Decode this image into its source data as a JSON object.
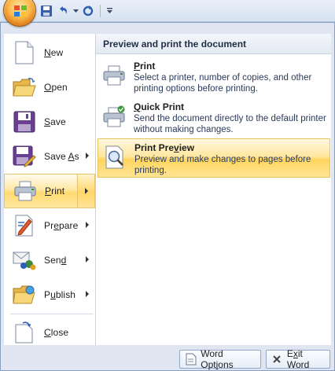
{
  "quick_access": {
    "save_icon": "save-icon",
    "undo_icon": "undo-icon",
    "redo_icon": "redo-icon",
    "customize_icon": "customize-qat-icon"
  },
  "left_menu": [
    {
      "label": "New",
      "accel": "N",
      "icon": "new-document-icon",
      "has_submenu": false
    },
    {
      "label": "Open",
      "accel": "O",
      "icon": "open-folder-icon",
      "has_submenu": false
    },
    {
      "label": "Save",
      "accel": "S",
      "icon": "save-disk-icon",
      "has_submenu": false
    },
    {
      "label": "Save As",
      "accel": "A",
      "icon": "save-as-icon",
      "has_submenu": true
    },
    {
      "label": "Print",
      "accel": "P",
      "icon": "printer-icon",
      "has_submenu": true,
      "selected": true
    },
    {
      "label": "Prepare",
      "accel": "E",
      "icon": "prepare-icon",
      "has_submenu": true
    },
    {
      "label": "Send",
      "accel": "D",
      "icon": "send-icon",
      "has_submenu": true
    },
    {
      "label": "Publish",
      "accel": "U",
      "icon": "publish-icon",
      "has_submenu": true
    },
    {
      "label": "Close",
      "accel": "C",
      "icon": "close-folder-icon",
      "has_submenu": false
    }
  ],
  "left_labels": {
    "new_pre": "",
    "new_acc": "N",
    "new_post": "ew",
    "open_pre": "",
    "open_acc": "O",
    "open_post": "pen",
    "save_pre": "",
    "save_acc": "S",
    "save_post": "ave",
    "saveas_pre": "Save ",
    "saveas_acc": "A",
    "saveas_post": "s",
    "print_pre": "",
    "print_acc": "P",
    "print_post": "rint",
    "prepare_pre": "Pr",
    "prepare_acc": "e",
    "prepare_post": "pare",
    "send_pre": "Sen",
    "send_acc": "d",
    "send_post": "",
    "publish_pre": "P",
    "publish_acc": "u",
    "publish_post": "blish",
    "close_pre": "",
    "close_acc": "C",
    "close_post": "lose"
  },
  "print_panel": {
    "header": "Preview and print the document",
    "items": [
      {
        "title_pre": "",
        "title_acc": "P",
        "title_post": "rint",
        "description": "Select a printer, number of copies, and other printing options before printing.",
        "icon": "printer-icon"
      },
      {
        "title_pre": "",
        "title_acc": "Q",
        "title_post": "uick Print",
        "description": "Send the document directly to the default printer without making changes.",
        "icon": "quick-print-icon"
      },
      {
        "title_pre": "Print Pre",
        "title_acc": "v",
        "title_post": "iew",
        "description": "Preview and make changes to pages before printing.",
        "icon": "print-preview-icon",
        "highlighted": true
      }
    ]
  },
  "bottom_buttons": {
    "options_pre": "Word Opt",
    "options_acc": "i",
    "options_post": "ons",
    "exit_pre": "E",
    "exit_acc": "x",
    "exit_post": "it Word"
  },
  "colors": {
    "highlight": "#ffd96f",
    "frame": "#dfe6f1",
    "header_text": "#1f2d46"
  }
}
